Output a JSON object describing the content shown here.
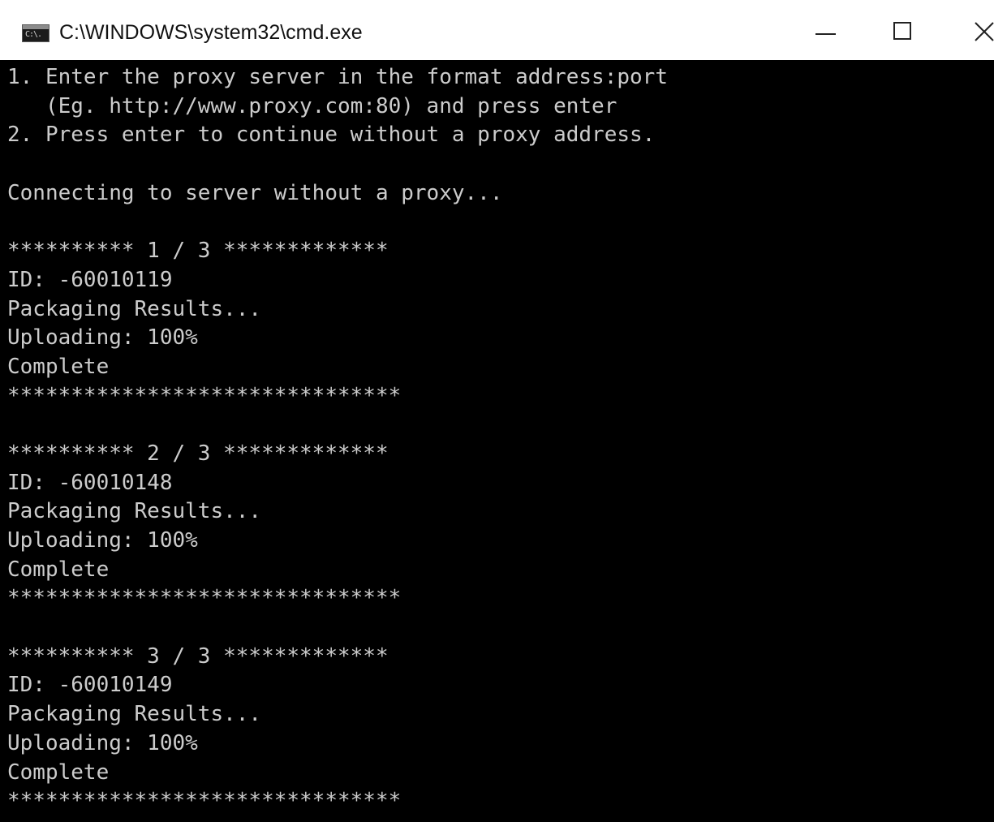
{
  "window": {
    "title": "C:\\WINDOWS\\system32\\cmd.exe",
    "icon": "cmd-icon",
    "icon_glyph": "C:\\."
  },
  "controls": {
    "minimize_icon": "minimize-icon",
    "maximize_icon": "maximize-icon",
    "close_icon": "close-icon"
  },
  "console": {
    "background": "#000000",
    "foreground": "#cccccc",
    "lines": [
      "1. Enter the proxy server in the format address:port",
      "   (Eg. http://www.proxy.com:80) and press enter",
      "2. Press enter to continue without a proxy address.",
      "",
      "Connecting to server without a proxy...",
      "",
      "********** 1 / 3 *************",
      "ID: -60010119",
      "Packaging Results...",
      "Uploading: 100%",
      "Complete",
      "*******************************",
      "",
      "********** 2 / 3 *************",
      "ID: -60010148",
      "Packaging Results...",
      "Uploading: 100%",
      "Complete",
      "*******************************",
      "",
      "********** 3 / 3 *************",
      "ID: -60010149",
      "Packaging Results...",
      "Uploading: 100%",
      "Complete",
      "*******************************"
    ]
  }
}
